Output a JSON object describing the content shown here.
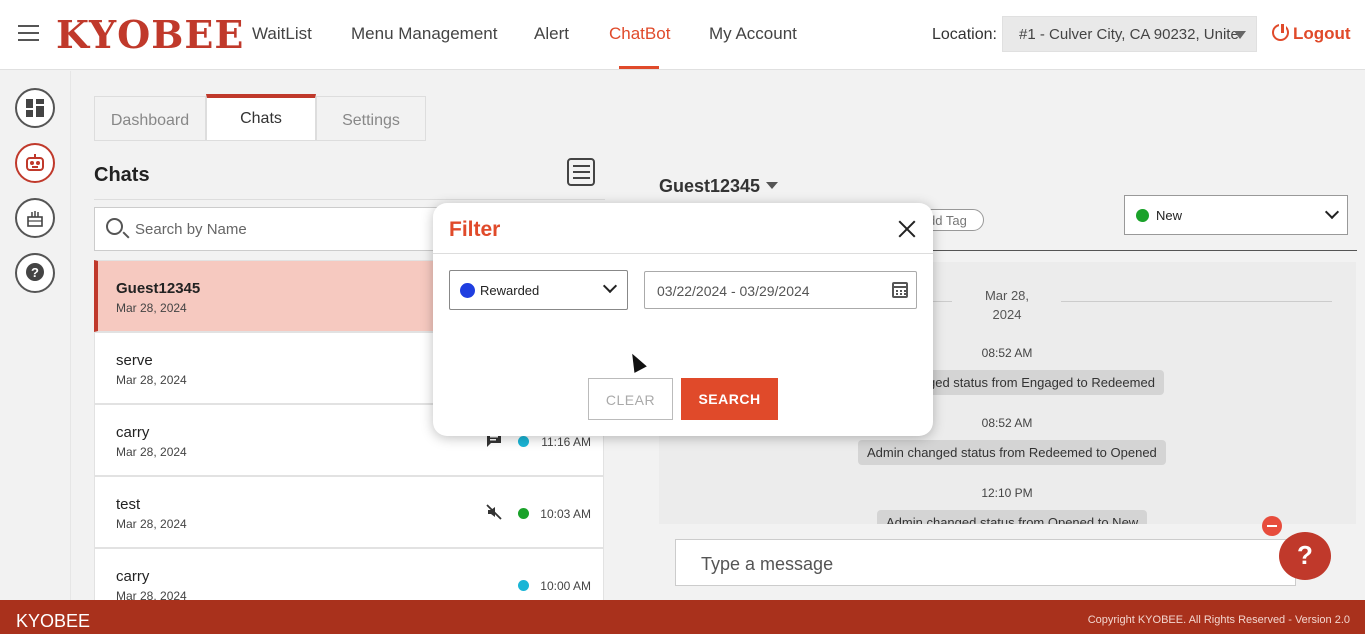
{
  "header": {
    "logo": "KYOBEE",
    "nav": [
      "WaitList",
      "Menu Management",
      "Alert",
      "ChatBot",
      "My Account"
    ],
    "active_nav": "ChatBot",
    "location_label": "Location:",
    "location_value": "#1 - Culver City, CA 90232, Unite",
    "logout_label": "Logout"
  },
  "rail": {
    "icons": [
      "dashboard-icon",
      "robot-icon",
      "cake-icon",
      "help-icon"
    ]
  },
  "tabs": [
    "Dashboard",
    "Chats",
    "Settings"
  ],
  "active_tab": "Chats",
  "chats": {
    "title": "Chats",
    "search_placeholder": "Search by Name",
    "items": [
      {
        "name": "Guest12345",
        "date": "Mar 28, 2024",
        "time": "",
        "status_color": ""
      },
      {
        "name": "serve",
        "date": "Mar 28, 2024",
        "time": "",
        "status_color": ""
      },
      {
        "name": "carry",
        "date": "Mar 28, 2024",
        "time": "11:16 AM",
        "status_color": "#1ab5d6",
        "icon": "chat-icon"
      },
      {
        "name": "test",
        "date": "Mar 28, 2024",
        "time": "10:03 AM",
        "status_color": "#1aa22a",
        "icon": "mute-icon"
      },
      {
        "name": "carry",
        "date": "Mar 28, 2024",
        "time": "10:00 AM",
        "status_color": "#1ab5d6"
      }
    ]
  },
  "conversation": {
    "guest_name": "Guest12345",
    "add_tag_label": "dd Tag",
    "status_value": "New",
    "status_color": "#1aa22a",
    "date_separator": "Mar 28,\n2024",
    "messages": [
      {
        "time": "08:52 AM",
        "text": "ged status from Engaged to Redeemed"
      },
      {
        "time": "08:52 AM",
        "text": "Admin changed status from Redeemed to Opened"
      },
      {
        "time": "12:10 PM",
        "text": "Admin changed status from Opened to New"
      }
    ],
    "input_placeholder": "Type a message"
  },
  "filter_modal": {
    "title": "Filter",
    "tag_value": "Rewarded",
    "tag_color": "#1f3ee0",
    "date_range": "03/22/2024 - 03/29/2024",
    "clear_label": "CLEAR",
    "search_label": "SEARCH"
  },
  "footer": {
    "brand": "KYOBEE",
    "copyright": "Copyright KYOBEE. All Rights Reserved - Version 2.0"
  },
  "colors": {
    "brand": "#c0392b",
    "accent": "#e04a2a",
    "footer_bg": "#a9311c"
  }
}
